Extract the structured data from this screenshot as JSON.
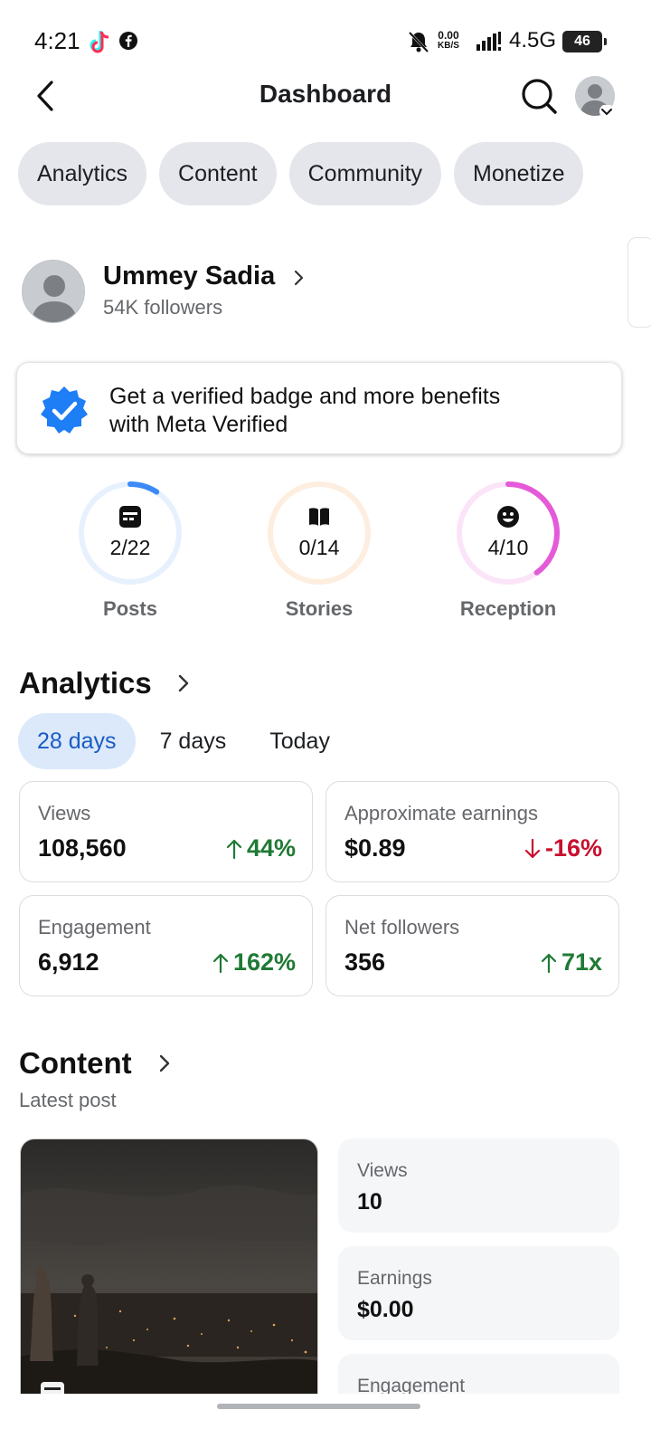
{
  "status_bar": {
    "time": "4:21",
    "rate_top": "0.00",
    "rate_bottom": "KB/S",
    "network": "4.5G",
    "battery": "46",
    "icons": [
      "tiktok-icon",
      "facebook-icon",
      "bell-muted-icon",
      "signal-icon",
      "battery-icon"
    ]
  },
  "header": {
    "title": "Dashboard",
    "icons": [
      "back-arrow-icon",
      "search-icon",
      "avatar",
      "chevron-down-icon"
    ]
  },
  "tabs": [
    {
      "label": "Analytics"
    },
    {
      "label": "Content"
    },
    {
      "label": "Community"
    },
    {
      "label": "Monetize"
    }
  ],
  "profile": {
    "name": "Ummey Sadia",
    "followers": "54K followers"
  },
  "verified_card": {
    "line1": "Get a verified badge and more benefits",
    "line2": "with Meta Verified",
    "icon": "verified-badge-icon"
  },
  "rings": [
    {
      "label": "Posts",
      "value": "2/22",
      "fraction": 0.0909,
      "color": "#3d8af7",
      "track": "#e7f1fe",
      "icon": "post-icon"
    },
    {
      "label": "Stories",
      "value": "0/14",
      "fraction": 0,
      "color": "#f7a44a",
      "track": "#fdeee0",
      "icon": "book-icon"
    },
    {
      "label": "Reception",
      "value": "4/10",
      "fraction": 0.4,
      "color": "#e45ad8",
      "track": "#fbe4f8",
      "icon": "smiley-icon"
    }
  ],
  "analytics": {
    "title": "Analytics",
    "ranges": [
      {
        "label": "28 days",
        "active": true
      },
      {
        "label": "7 days",
        "active": false
      },
      {
        "label": "Today",
        "active": false
      }
    ],
    "metrics": [
      {
        "label": "Views",
        "value": "108,560",
        "change": "44%",
        "direction": "up"
      },
      {
        "label": "Approximate earnings",
        "value": "$0.89",
        "change": "-16%",
        "direction": "down"
      },
      {
        "label": "Engagement",
        "value": "6,912",
        "change": "162%",
        "direction": "up"
      },
      {
        "label": "Net followers",
        "value": "356",
        "change": "71x",
        "direction": "up"
      }
    ]
  },
  "content": {
    "title": "Content",
    "subtitle": "Latest post",
    "stats": [
      {
        "label": "Views",
        "value": "10"
      },
      {
        "label": "Earnings",
        "value": "$0.00"
      },
      {
        "label": "Engagement",
        "value": ""
      }
    ]
  },
  "colors": {
    "accent_blue": "#1a5bc4",
    "positive": "#1f7a34",
    "negative": "#c8102e"
  }
}
